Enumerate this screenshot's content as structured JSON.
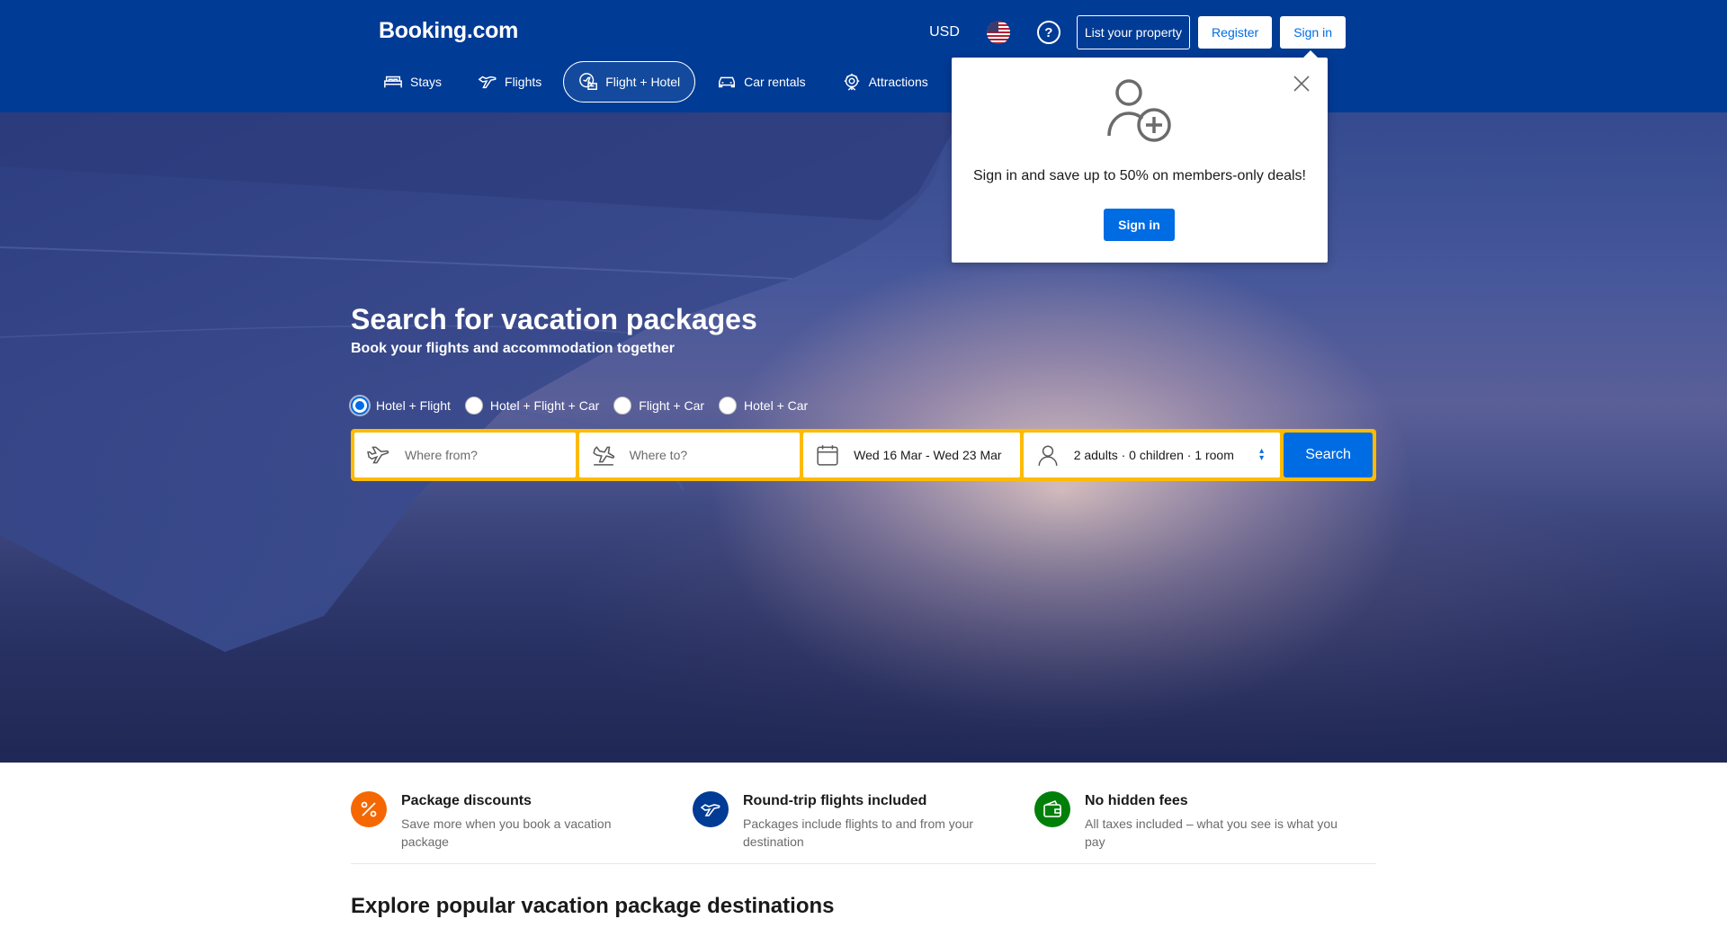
{
  "header": {
    "logo": "Booking.com",
    "currency": "USD",
    "flag_icon": "us-flag-icon",
    "help_icon": "help-icon",
    "list_property": "List your property",
    "register": "Register",
    "sign_in": "Sign in",
    "background": "#003b95"
  },
  "nav": {
    "items": [
      {
        "label": "Stays",
        "icon": "bed-icon"
      },
      {
        "label": "Flights",
        "icon": "plane-icon"
      },
      {
        "label": "Flight + Hotel",
        "icon": "flight-hotel-icon",
        "active": true
      },
      {
        "label": "Car rentals",
        "icon": "car-icon"
      },
      {
        "label": "Attractions",
        "icon": "attractions-icon"
      }
    ]
  },
  "hero": {
    "title": "Search for vacation packages",
    "subtitle": "Book your flights and accommodation together",
    "package_options": [
      {
        "label": "Hotel + Flight",
        "checked": true
      },
      {
        "label": "Hotel + Flight + Car",
        "checked": false
      },
      {
        "label": "Flight + Car",
        "checked": false
      },
      {
        "label": "Hotel + Car",
        "checked": false
      }
    ]
  },
  "search": {
    "from_placeholder": "Where from?",
    "to_placeholder": "Where to?",
    "dates": "Wed 16 Mar - Wed 23 Mar",
    "guests": "2 adults · 0 children · 1 room",
    "button": "Search",
    "frame_color": "#febb02",
    "accent": "#006ce4"
  },
  "popover": {
    "message": "Sign in and save up to 50% on members-only deals!",
    "button": "Sign in",
    "icon": "user-plus-icon",
    "close_icon": "close-icon"
  },
  "features": [
    {
      "title": "Package discounts",
      "desc": "Save more when you book a vacation package",
      "icon": "percent-icon",
      "color": "#f56700"
    },
    {
      "title": "Round-trip flights included",
      "desc": "Packages include flights to and from your destination",
      "icon": "plane-icon",
      "color": "#003b95"
    },
    {
      "title": "No hidden fees",
      "desc": "All taxes included – what you see is what you pay",
      "icon": "wallet-icon",
      "color": "#008009"
    }
  ],
  "section": {
    "title": "Explore popular vacation package destinations"
  }
}
